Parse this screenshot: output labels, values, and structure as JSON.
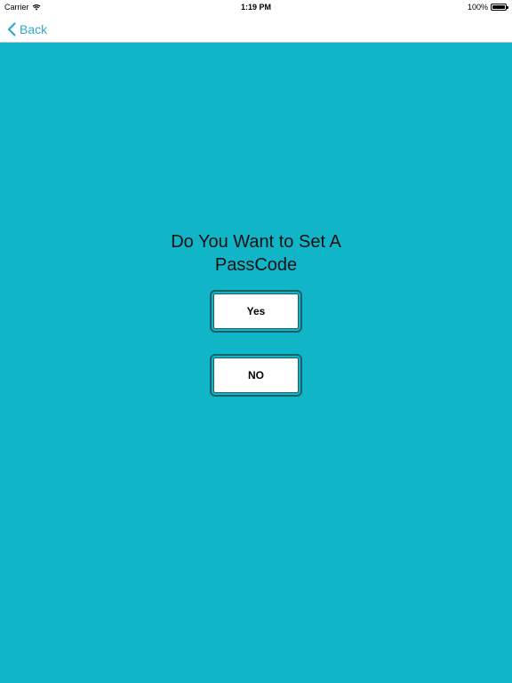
{
  "status_bar": {
    "carrier": "Carrier",
    "time": "1:19 PM",
    "battery_percent": "100%",
    "battery_level": 1.0
  },
  "nav": {
    "back_label": "Back"
  },
  "main": {
    "prompt_line1": "Do You Want to Set A",
    "prompt_line2": "PassCode",
    "yes_label": "Yes",
    "no_label": "NO"
  },
  "colors": {
    "background": "#10b5c8",
    "accent": "#2fa9c9",
    "button_border": "#1f5f67"
  }
}
